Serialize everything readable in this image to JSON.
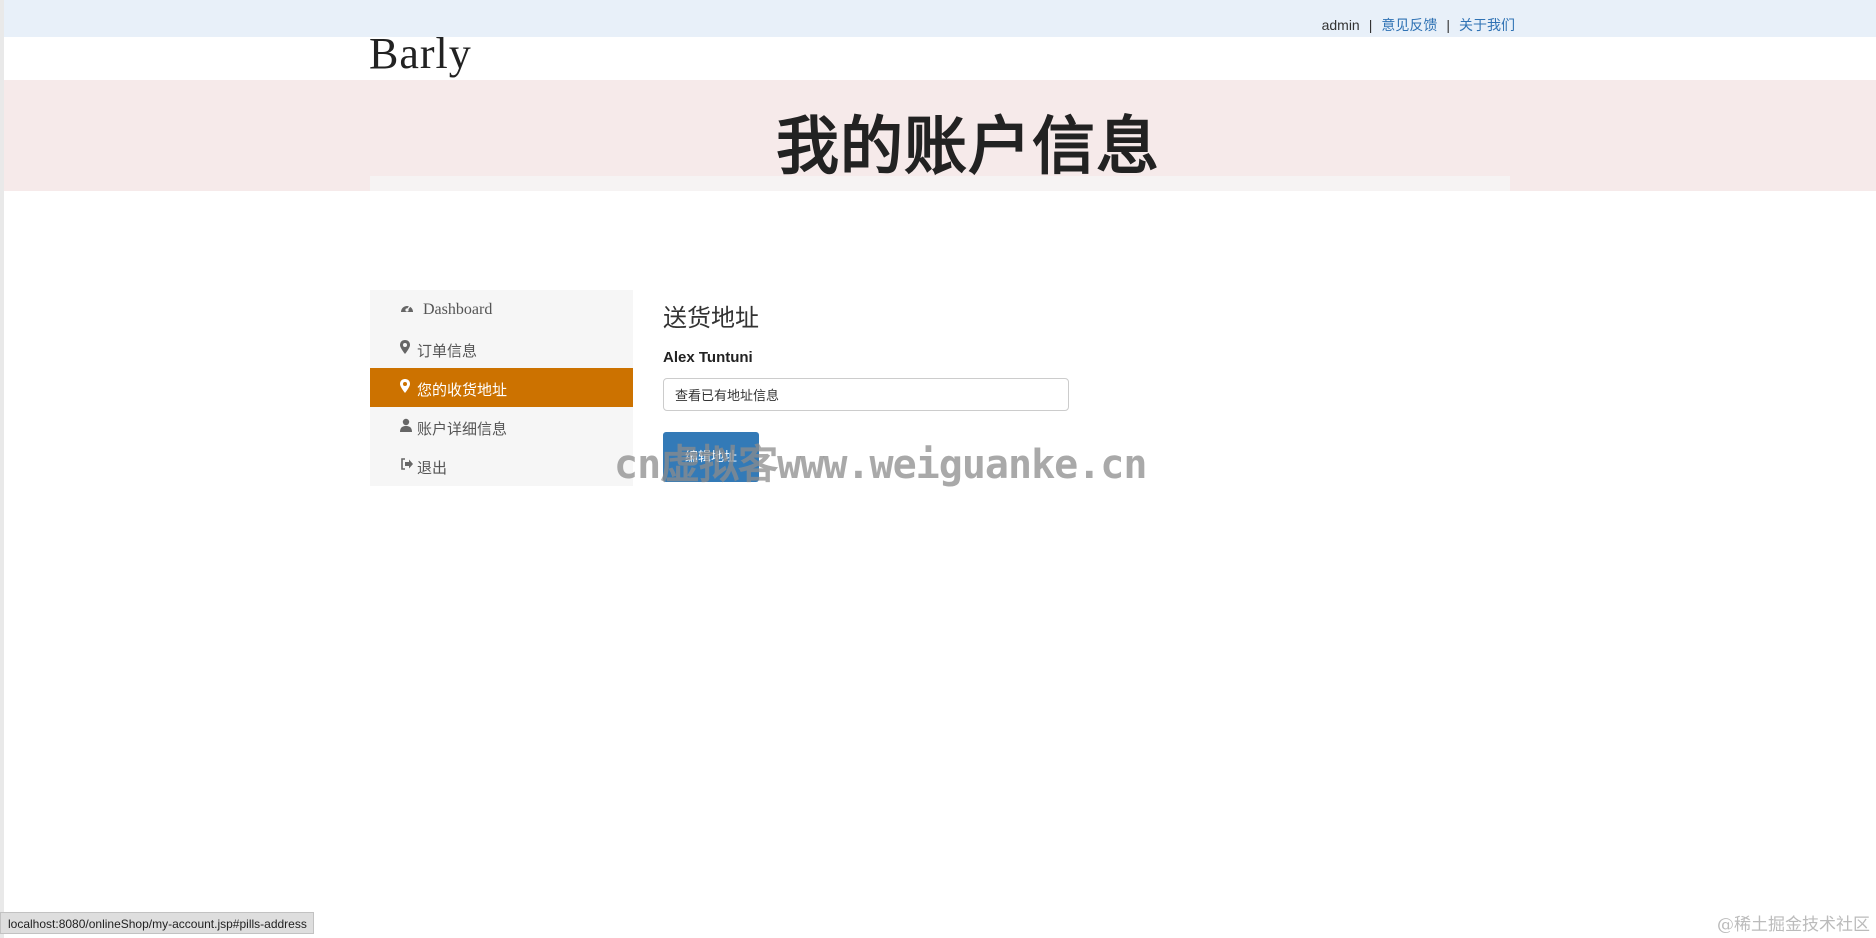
{
  "topbar": {
    "user": "admin",
    "separator": "|",
    "feedback": "意见反馈",
    "about": "关于我们"
  },
  "brand": {
    "logo": "Barly"
  },
  "banner": {
    "title": "我的账户信息"
  },
  "sidebar": {
    "items": [
      {
        "label": "Dashboard",
        "icon": "dashboard-icon",
        "active": false
      },
      {
        "label": "订单信息",
        "icon": "map-marker-icon",
        "active": false
      },
      {
        "label": "您的收货地址",
        "icon": "map-marker-icon",
        "active": true
      },
      {
        "label": "账户详细信息",
        "icon": "user-icon",
        "active": false
      },
      {
        "label": "退出",
        "icon": "sign-out-icon",
        "active": false
      }
    ]
  },
  "main": {
    "section_title": "送货地址",
    "name": "Alex Tuntuni",
    "address_value": "查看已有地址信息",
    "edit_button": "编辑地址"
  },
  "overlay": {
    "watermark": "cn虚拟客www.weiguanke.cn",
    "corner_watermark": "@稀土掘金技术社区"
  },
  "statusbar": {
    "url": "localhost:8080/onlineShop/my-account.jsp#pills-address"
  },
  "colors": {
    "accent": "#cc7200",
    "button": "#337ab7",
    "link": "#2f72b4",
    "topbar": "#e8f0f9",
    "banner": "#f6eaea"
  }
}
